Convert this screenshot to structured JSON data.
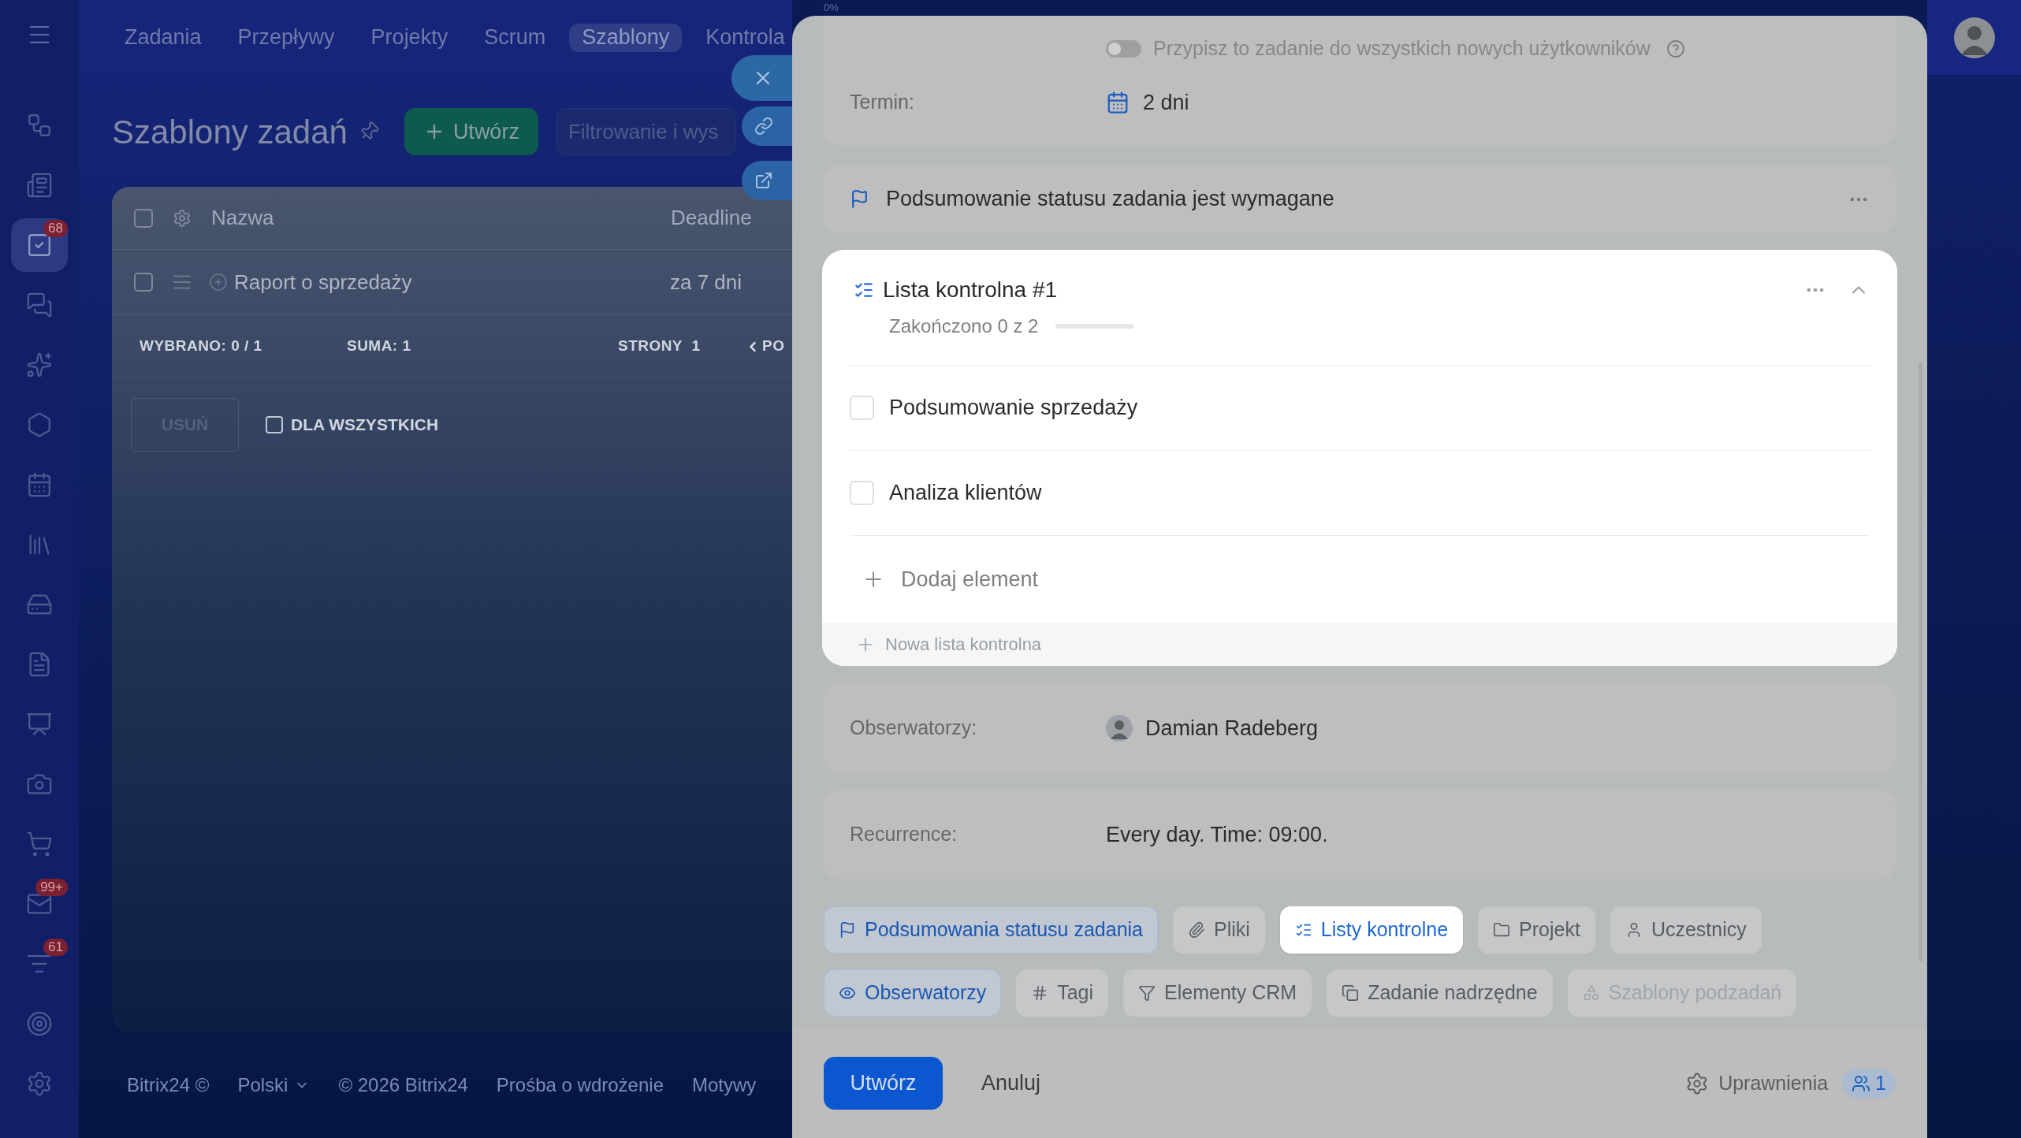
{
  "sidebar": {
    "items": [
      {
        "kind": "flows",
        "selected": false
      },
      {
        "kind": "feed",
        "selected": false
      },
      {
        "kind": "tasks",
        "selected": true,
        "badge": "68"
      },
      {
        "kind": "chat",
        "selected": false
      },
      {
        "kind": "ai",
        "selected": false
      },
      {
        "kind": "hexagon",
        "selected": false
      },
      {
        "kind": "calendar",
        "selected": false
      },
      {
        "kind": "library",
        "selected": false
      },
      {
        "kind": "drive",
        "selected": false
      },
      {
        "kind": "docs",
        "selected": false
      },
      {
        "kind": "board",
        "selected": false
      },
      {
        "kind": "camera",
        "selected": false
      },
      {
        "kind": "cart",
        "selected": false
      },
      {
        "kind": "mail",
        "selected": false,
        "badge": "99+"
      },
      {
        "kind": "filter",
        "selected": false,
        "badge": "61"
      },
      {
        "kind": "target",
        "selected": false
      },
      {
        "kind": "settings",
        "selected": false
      }
    ]
  },
  "top_nav": {
    "tabs": [
      {
        "label": "Zadania",
        "selected": false
      },
      {
        "label": "Przepływy",
        "selected": false
      },
      {
        "label": "Projekty",
        "selected": false
      },
      {
        "label": "Scrum",
        "selected": false
      },
      {
        "label": "Szablony",
        "selected": true
      },
      {
        "label": "Kontrola",
        "selected": false
      }
    ]
  },
  "page": {
    "title": "Szablony zadań",
    "create_button": "Utwórz",
    "filter_placeholder": "Filtrowanie i wys"
  },
  "table": {
    "header_checked": false,
    "columns": [
      "Nazwa",
      "Deadline"
    ],
    "rows": [
      {
        "name": "Raport o sprzedaży",
        "deadline": "za 7 dni",
        "checked": false
      }
    ],
    "footer": {
      "selected_label": "WYBRANO:",
      "selected_value": "0 / 1",
      "total_label": "SUMA:",
      "total_value": "1",
      "pages_label": "STRONY",
      "pages_value": "1",
      "prev": "PO"
    },
    "actions": {
      "delete_button": "USUŃ",
      "for_all": {
        "label": "DLA WSZYSTKICH",
        "checked": false
      }
    }
  },
  "footer_links": [
    "Bitrix24 ©",
    "Polski",
    "© 2026 Bitrix24",
    "Prośba o wdrożenie",
    "Motywy"
  ],
  "panel": {
    "progress_caption": "0%",
    "assign_all": {
      "label": "Przypisz to zadanie do wszystkich nowych użytkowników",
      "on": false
    },
    "deadline": {
      "label": "Termin:",
      "value": "2 dni"
    },
    "status_summary": {
      "text": "Podsumowanie statusu zadania jest wymagane"
    },
    "checklist": {
      "title": "Lista kontrolna #1",
      "progress_text": "Zakończono 0 z 2",
      "level": 0,
      "expanded": true,
      "items": [
        {
          "text": "Podsumowanie sprzedaży",
          "checked": false
        },
        {
          "text": "Analiza klientów",
          "checked": false
        }
      ],
      "add_item": "Dodaj element",
      "new_list": "Nowa lista kontrolna"
    },
    "observers": {
      "label": "Obserwatorzy:",
      "name": "Damian Radeberg"
    },
    "recurrence": {
      "label": "Recurrence:",
      "value": "Every day. Time: 09:00."
    },
    "chip_rows": [
      [
        {
          "kind": "summary",
          "label": "Podsumowania statusu zadania",
          "active": true,
          "selected": false,
          "disabled": false
        },
        {
          "kind": "files",
          "label": "Pliki",
          "active": false,
          "selected": false,
          "disabled": false
        },
        {
          "kind": "checklist",
          "label": "Listy kontrolne",
          "active": false,
          "selected": true,
          "disabled": false
        },
        {
          "kind": "project",
          "label": "Projekt",
          "active": false,
          "selected": false,
          "disabled": false
        },
        {
          "kind": "participants",
          "label": "Uczestnicy",
          "active": false,
          "selected": false,
          "disabled": false
        }
      ],
      [
        {
          "kind": "observers",
          "label": "Obserwatorzy",
          "active": true,
          "selected": false,
          "disabled": false
        },
        {
          "kind": "tags",
          "label": "Tagi",
          "active": false,
          "selected": false,
          "disabled": false
        },
        {
          "kind": "crm",
          "label": "Elementy CRM",
          "active": false,
          "selected": false,
          "disabled": false
        },
        {
          "kind": "parent",
          "label": "Zadanie nadrzędne",
          "active": false,
          "selected": false,
          "disabled": false
        },
        {
          "kind": "subtasks",
          "label": "Szablony podzadań",
          "active": false,
          "selected": false,
          "disabled": true
        }
      ]
    ],
    "footer": {
      "create": "Utwórz",
      "cancel": "Anuluj",
      "permissions": "Uprawnienia",
      "participants_count": "1"
    }
  }
}
